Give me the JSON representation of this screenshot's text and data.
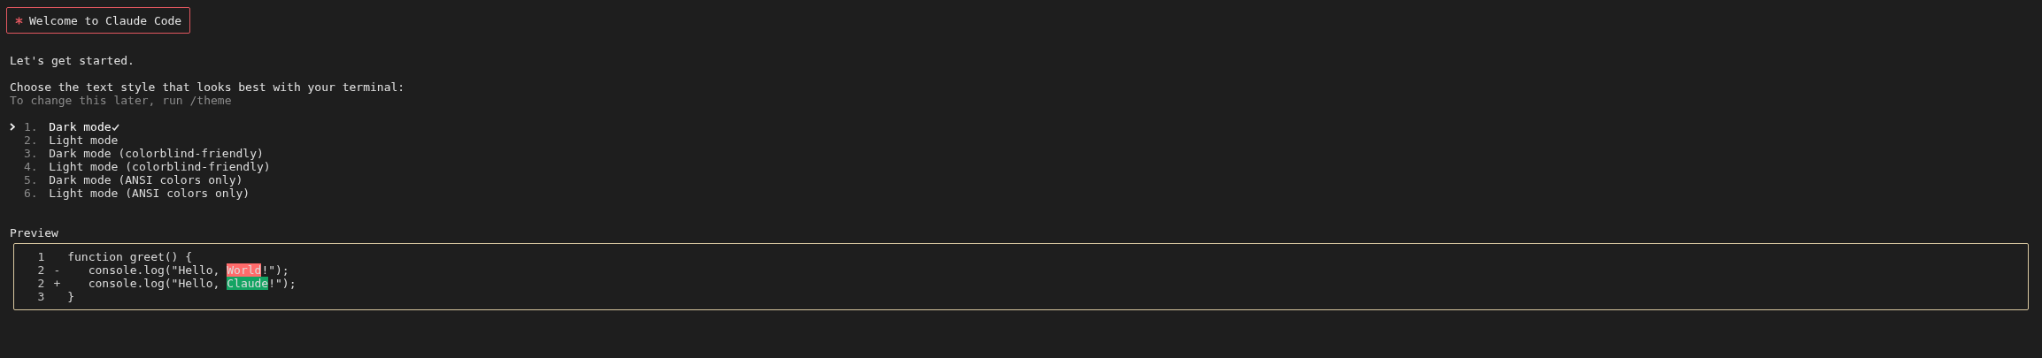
{
  "welcome": {
    "title": "Welcome to Claude Code"
  },
  "intro": "Let's get started.",
  "prompt": "Choose the text style that looks best with your terminal:",
  "hint": "To change this later, run /theme",
  "options": [
    {
      "number": "1.",
      "label": "Dark mode",
      "selected": true
    },
    {
      "number": "2.",
      "label": "Light mode",
      "selected": false
    },
    {
      "number": "3.",
      "label": "Dark mode (colorblind-friendly)",
      "selected": false
    },
    {
      "number": "4.",
      "label": "Light mode (colorblind-friendly)",
      "selected": false
    },
    {
      "number": "5.",
      "label": "Dark mode (ANSI colors only)",
      "selected": false
    },
    {
      "number": "6.",
      "label": "Light mode (ANSI colors only)",
      "selected": false
    }
  ],
  "preview": {
    "title": "Preview",
    "lines": [
      {
        "number": "1",
        "kind": "context",
        "parts": [
          {
            "text": "function greet() {",
            "highlight": false
          }
        ]
      },
      {
        "number": "2",
        "sign": "-",
        "kind": "removed",
        "parts": [
          {
            "text": "   console.log(\"Hello, ",
            "highlight": false
          },
          {
            "text": "World",
            "highlight": true
          },
          {
            "text": "!\");",
            "highlight": false
          }
        ]
      },
      {
        "number": "2",
        "sign": "+",
        "kind": "added",
        "parts": [
          {
            "text": "   console.log(\"Hello, ",
            "highlight": false
          },
          {
            "text": "Claude",
            "highlight": true
          },
          {
            "text": "!\");",
            "highlight": false
          }
        ]
      },
      {
        "number": "3",
        "kind": "context",
        "parts": [
          {
            "text": "}",
            "highlight": false
          }
        ]
      }
    ]
  }
}
